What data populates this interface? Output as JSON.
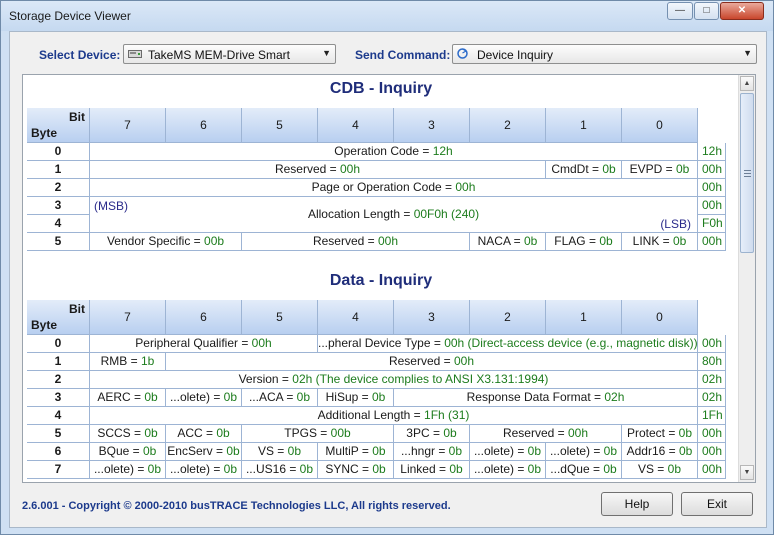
{
  "window": {
    "title": "Storage Device Viewer"
  },
  "toolbar": {
    "select_device_label": "Select Device:",
    "device_value": "TakeMS MEM-Drive Smart",
    "send_command_label": "Send Command:",
    "command_value": "Device Inquiry"
  },
  "grid_header": {
    "bit_label": "Bit",
    "byte_label": "Byte",
    "bits": [
      "7",
      "6",
      "5",
      "4",
      "3",
      "2",
      "1",
      "0"
    ]
  },
  "cdb": {
    "title": "CDB - Inquiry",
    "rows": [
      {
        "byte": "0",
        "hex": "12h",
        "fields": [
          {
            "span": 8,
            "name": "Operation Code = ",
            "val": "12h"
          }
        ]
      },
      {
        "byte": "1",
        "hex": "00h",
        "fields": [
          {
            "span": 6,
            "name": "Reserved = ",
            "val": "00h"
          },
          {
            "span": 1,
            "name": "CmdDt = ",
            "val": "0b"
          },
          {
            "span": 1,
            "name": "EVPD = ",
            "val": "0b"
          }
        ]
      },
      {
        "byte": "2",
        "hex": "00h",
        "fields": [
          {
            "span": 8,
            "name": "Page or Operation Code = ",
            "val": "00h"
          }
        ]
      },
      {
        "byte": "3",
        "hex": "00h"
      },
      {
        "byte": "4",
        "hex": "F0h"
      },
      {
        "byte": "5",
        "hex": "00h",
        "fields": [
          {
            "span": 2,
            "name": "Vendor Specific = ",
            "val": "00b"
          },
          {
            "span": 3,
            "name": "Reserved = ",
            "val": "00h"
          },
          {
            "span": 1,
            "name": "NACA = ",
            "val": "0b"
          },
          {
            "span": 1,
            "name": "FLAG = ",
            "val": "0b"
          },
          {
            "span": 1,
            "name": "LINK = ",
            "val": "0b"
          }
        ]
      }
    ],
    "alloc": {
      "name": "Allocation Length = ",
      "val": "00F0h (240)",
      "msb": "(MSB)",
      "lsb": "(LSB)"
    }
  },
  "data": {
    "title": "Data - Inquiry",
    "rows": [
      {
        "byte": "0",
        "hex": "00h",
        "fields": [
          {
            "span": 3,
            "name": "Peripheral Qualifier = ",
            "val": "00h"
          },
          {
            "span": 5,
            "name": "...pheral Device Type = ",
            "val": "00h (Direct-access device (e.g., magnetic disk))"
          }
        ]
      },
      {
        "byte": "1",
        "hex": "80h",
        "fields": [
          {
            "span": 1,
            "name": "RMB = ",
            "val": "1b"
          },
          {
            "span": 7,
            "name": "Reserved = ",
            "val": "00h"
          }
        ]
      },
      {
        "byte": "2",
        "hex": "02h",
        "fields": [
          {
            "span": 8,
            "name": "Version = ",
            "val": "02h (The device complies to ANSI X3.131:1994)"
          }
        ]
      },
      {
        "byte": "3",
        "hex": "02h",
        "fields": [
          {
            "span": 1,
            "name": "AERC = ",
            "val": "0b"
          },
          {
            "span": 1,
            "name": "...olete) = ",
            "val": "0b"
          },
          {
            "span": 1,
            "name": "...ACA = ",
            "val": "0b"
          },
          {
            "span": 1,
            "name": "HiSup = ",
            "val": "0b"
          },
          {
            "span": 4,
            "name": "Response Data Format = ",
            "val": "02h"
          }
        ]
      },
      {
        "byte": "4",
        "hex": "1Fh",
        "fields": [
          {
            "span": 8,
            "name": "Additional Length = ",
            "val": "1Fh (31)"
          }
        ]
      },
      {
        "byte": "5",
        "hex": "00h",
        "fields": [
          {
            "span": 1,
            "name": "SCCS = ",
            "val": "0b"
          },
          {
            "span": 1,
            "name": "ACC = ",
            "val": "0b"
          },
          {
            "span": 2,
            "name": "TPGS = ",
            "val": "00b"
          },
          {
            "span": 1,
            "name": "3PC = ",
            "val": "0b"
          },
          {
            "span": 2,
            "name": "Reserved = ",
            "val": "00h"
          },
          {
            "span": 1,
            "name": "Protect = ",
            "val": "0b"
          }
        ]
      },
      {
        "byte": "6",
        "hex": "00h",
        "fields": [
          {
            "span": 1,
            "name": "BQue = ",
            "val": "0b"
          },
          {
            "span": 1,
            "name": "EncServ = ",
            "val": "0b"
          },
          {
            "span": 1,
            "name": "VS = ",
            "val": "0b"
          },
          {
            "span": 1,
            "name": "MultiP = ",
            "val": "0b"
          },
          {
            "span": 1,
            "name": "...hngr = ",
            "val": "0b"
          },
          {
            "span": 1,
            "name": "...olete) = ",
            "val": "0b"
          },
          {
            "span": 1,
            "name": "...olete) = ",
            "val": "0b"
          },
          {
            "span": 1,
            "name": "Addr16 = ",
            "val": "0b"
          }
        ]
      },
      {
        "byte": "7",
        "hex": "00h",
        "fields": [
          {
            "span": 1,
            "name": "...olete) = ",
            "val": "0b"
          },
          {
            "span": 1,
            "name": "...olete) = ",
            "val": "0b"
          },
          {
            "span": 1,
            "name": "...US16 = ",
            "val": "0b"
          },
          {
            "span": 1,
            "name": "SYNC = ",
            "val": "0b"
          },
          {
            "span": 1,
            "name": "Linked = ",
            "val": "0b"
          },
          {
            "span": 1,
            "name": "...olete) = ",
            "val": "0b"
          },
          {
            "span": 1,
            "name": "...dQue = ",
            "val": "0b"
          },
          {
            "span": 1,
            "name": "VS = ",
            "val": "0b"
          }
        ]
      }
    ]
  },
  "footer": {
    "copyright": "2.6.001 - Copyright © 2000-2010 busTRACE Technologies LLC,  All rights reserved.",
    "help_label": "Help",
    "exit_label": "Exit"
  }
}
